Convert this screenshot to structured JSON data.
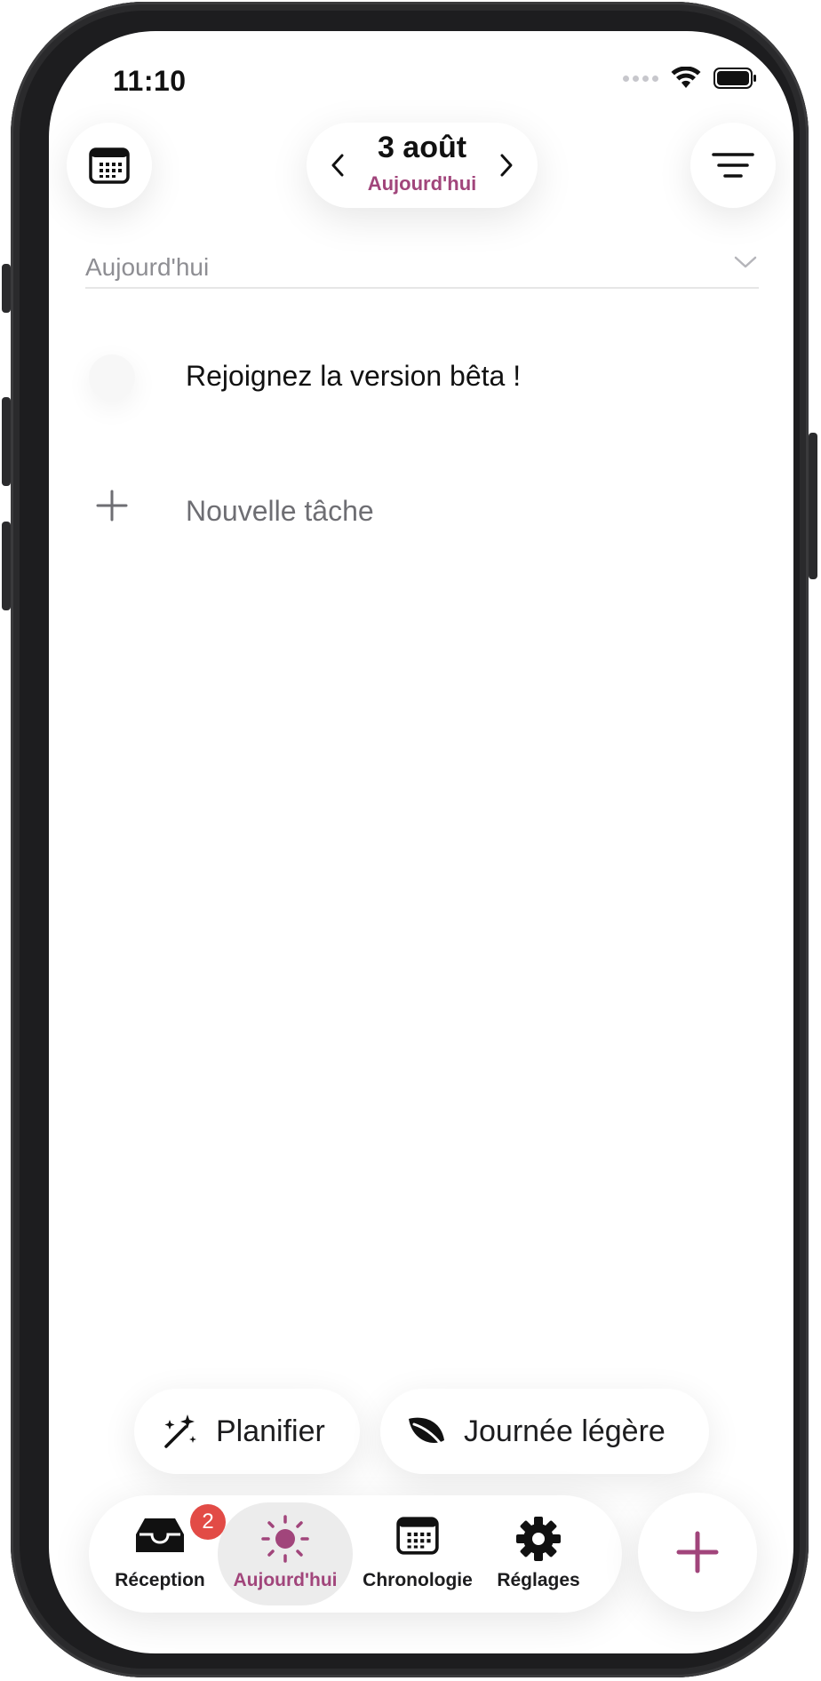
{
  "status_bar": {
    "time": "11:10"
  },
  "header": {
    "calendar_button_icon": "calendar-icon",
    "date": "3 août",
    "date_subtitle": "Aujourd'hui",
    "menu_button_icon": "filter-lines-icon"
  },
  "section": {
    "title": "Aujourd'hui"
  },
  "tasks": [
    {
      "title": "Rejoignez la version bêta !",
      "done": false
    }
  ],
  "new_task": {
    "label": "Nouvelle tâche"
  },
  "actions": {
    "plan_label": "Planifier",
    "light_day_label": "Journée légère"
  },
  "tabbar": {
    "items": [
      {
        "label": "Réception",
        "icon": "inbox-icon",
        "badge": "2"
      },
      {
        "label": "Aujourd'hui",
        "icon": "sun-icon",
        "active": true
      },
      {
        "label": "Chronologie",
        "icon": "calendar-icon"
      },
      {
        "label": "Réglages",
        "icon": "gear-icon"
      }
    ]
  },
  "colors": {
    "accent": "#a1457b",
    "badge": "#e24b46"
  }
}
